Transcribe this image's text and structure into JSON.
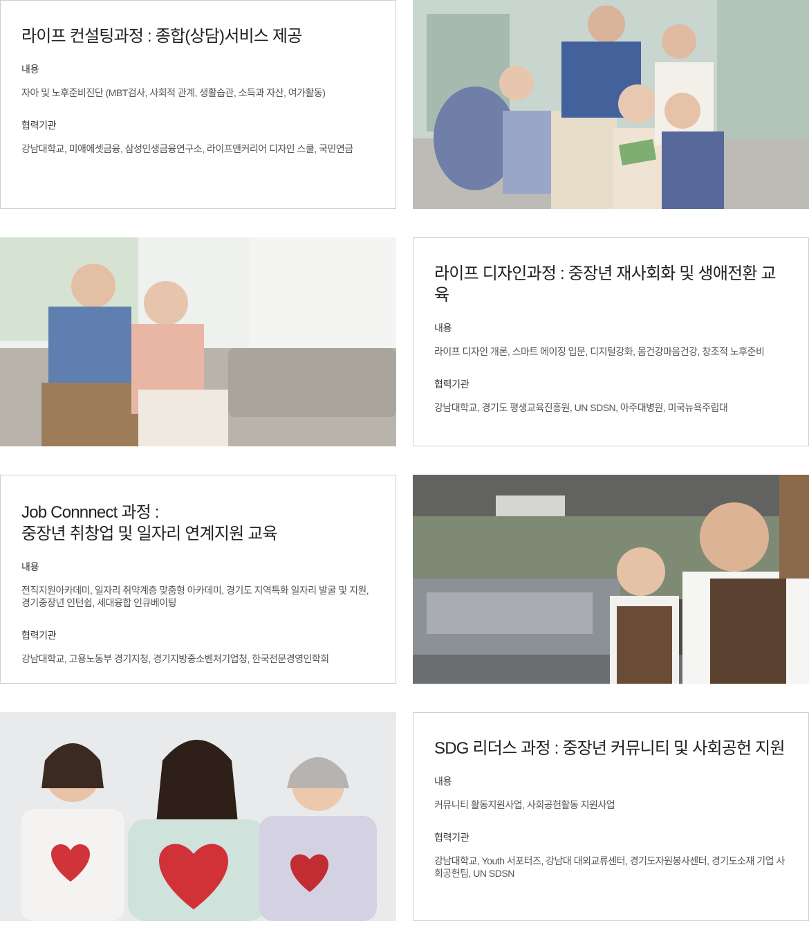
{
  "programs": [
    {
      "title": "라이프 컨설팅과정 : 종합(상담)서비스 제공",
      "content_label": "내용",
      "content": "자아 및 노후준비진단 (MBT검사, 사회적 관계, 생활습관, 소득과 자산, 여가활동)",
      "partners_label": "협력기관",
      "partners": "강남대학교, 미애에셋금융, 삼성인생금융연구소, 라이프앤커리어 디자인 스쿨, 국민연금"
    },
    {
      "title": "라이프 디자인과정 : 중장년 재사회화 및 생애전환 교육",
      "content_label": "내용",
      "content": "라이프 디자인 개론, 스마트 에이징 입문, 디지털강화, 몸건강마음건강, 창조적 노후준비",
      "partners_label": "협력기관",
      "partners": "강남대학교, 경기도 평생교육진흥원, UN SDSN, 아주대병원, 미국뉴욕주립대"
    },
    {
      "title_line1": "Job Connnect 과정 :",
      "title_line2": "중장년 취창업 및 일자리 연계지원 교육",
      "content_label": "내용",
      "content": "전직지원아카데미, 일자리 취약계층 맞춤형 아카데미, 경기도 지역특화 일자리 발굴 및 지원, 경기중장년 인턴쉽, 세대융합 인큐베이팅",
      "partners_label": "협력기관",
      "partners": "강남대학교, 고용노동부 경기지청, 경기지방중소벤처기업청, 한국전문경영인학회"
    },
    {
      "title": "SDG 리더스 과정 : 중장년 커뮤니티 및 사회공헌 지원",
      "content_label": "내용",
      "content": "커뮤니티 활동지원사업, 사회공헌활동 지원사업",
      "partners_label": "협력기관",
      "partners": "강남대학교, Youth 서포터즈, 강남대 대외교류센터, 경기도자원봉사센터, 경기도소재 기업 사회공헌팀, UN SDSN"
    }
  ]
}
